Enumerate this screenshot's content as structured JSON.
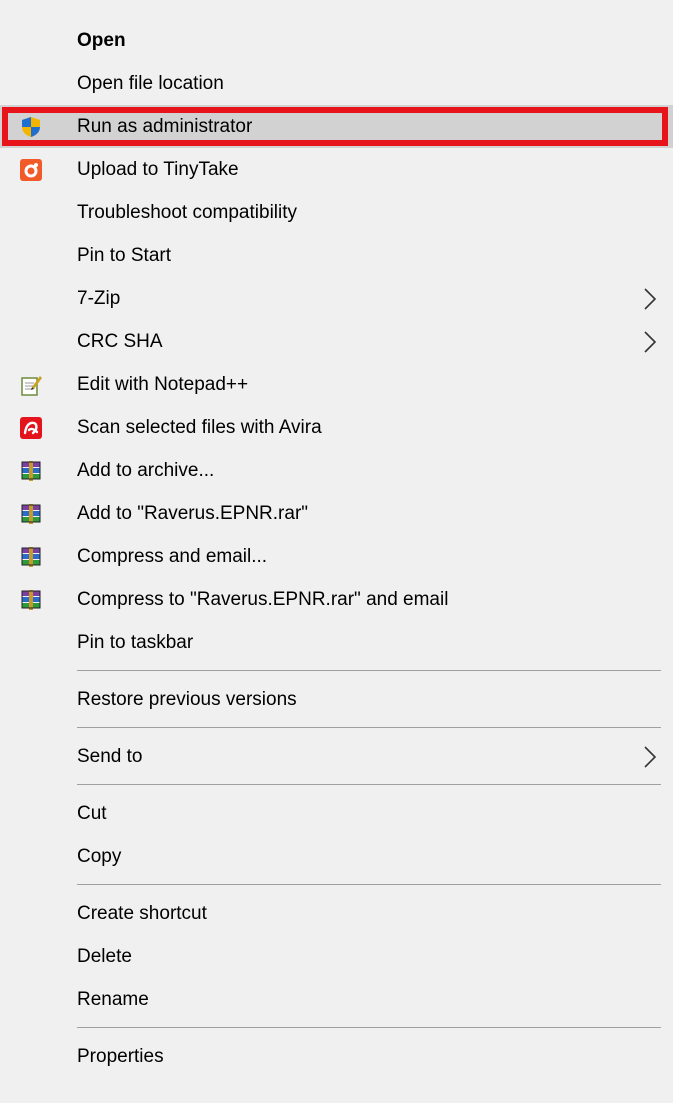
{
  "menu": {
    "groups": [
      [
        {
          "label": "Open",
          "bold": true,
          "icon": "",
          "submenu": false
        },
        {
          "label": "Open file location",
          "icon": "",
          "submenu": false
        },
        {
          "label": "Run as administrator",
          "icon": "uac-shield-icon",
          "submenu": false,
          "highlighted": true
        },
        {
          "label": "Upload to TinyTake",
          "icon": "tinytake-icon",
          "submenu": false
        },
        {
          "label": "Troubleshoot compatibility",
          "icon": "",
          "submenu": false
        },
        {
          "label": "Pin to Start",
          "icon": "",
          "submenu": false
        },
        {
          "label": "7-Zip",
          "icon": "",
          "submenu": true
        },
        {
          "label": "CRC SHA",
          "icon": "",
          "submenu": true
        },
        {
          "label": "Edit with Notepad++",
          "icon": "notepadpp-icon",
          "submenu": false
        },
        {
          "label": "Scan selected files with Avira",
          "icon": "avira-icon",
          "submenu": false
        },
        {
          "label": "Add to archive...",
          "icon": "winrar-icon",
          "submenu": false
        },
        {
          "label": "Add to \"Raverus.EPNR.rar\"",
          "icon": "winrar-icon",
          "submenu": false
        },
        {
          "label": "Compress and email...",
          "icon": "winrar-icon",
          "submenu": false
        },
        {
          "label": "Compress to \"Raverus.EPNR.rar\" and email",
          "icon": "winrar-icon",
          "submenu": false
        },
        {
          "label": "Pin to taskbar",
          "icon": "",
          "submenu": false
        }
      ],
      [
        {
          "label": "Restore previous versions",
          "icon": "",
          "submenu": false
        }
      ],
      [
        {
          "label": "Send to",
          "icon": "",
          "submenu": true
        }
      ],
      [
        {
          "label": "Cut",
          "icon": "",
          "submenu": false
        },
        {
          "label": "Copy",
          "icon": "",
          "submenu": false
        }
      ],
      [
        {
          "label": "Create shortcut",
          "icon": "",
          "submenu": false
        },
        {
          "label": "Delete",
          "icon": "",
          "submenu": false
        },
        {
          "label": "Rename",
          "icon": "",
          "submenu": false
        }
      ],
      [
        {
          "label": "Properties",
          "icon": "",
          "submenu": false
        }
      ]
    ]
  },
  "colors": {
    "menu_background": "#f0f0f0",
    "hover_background": "#d2d2d2",
    "annotation_outline": "#e8141c",
    "separator": "#a0a0a0"
  }
}
